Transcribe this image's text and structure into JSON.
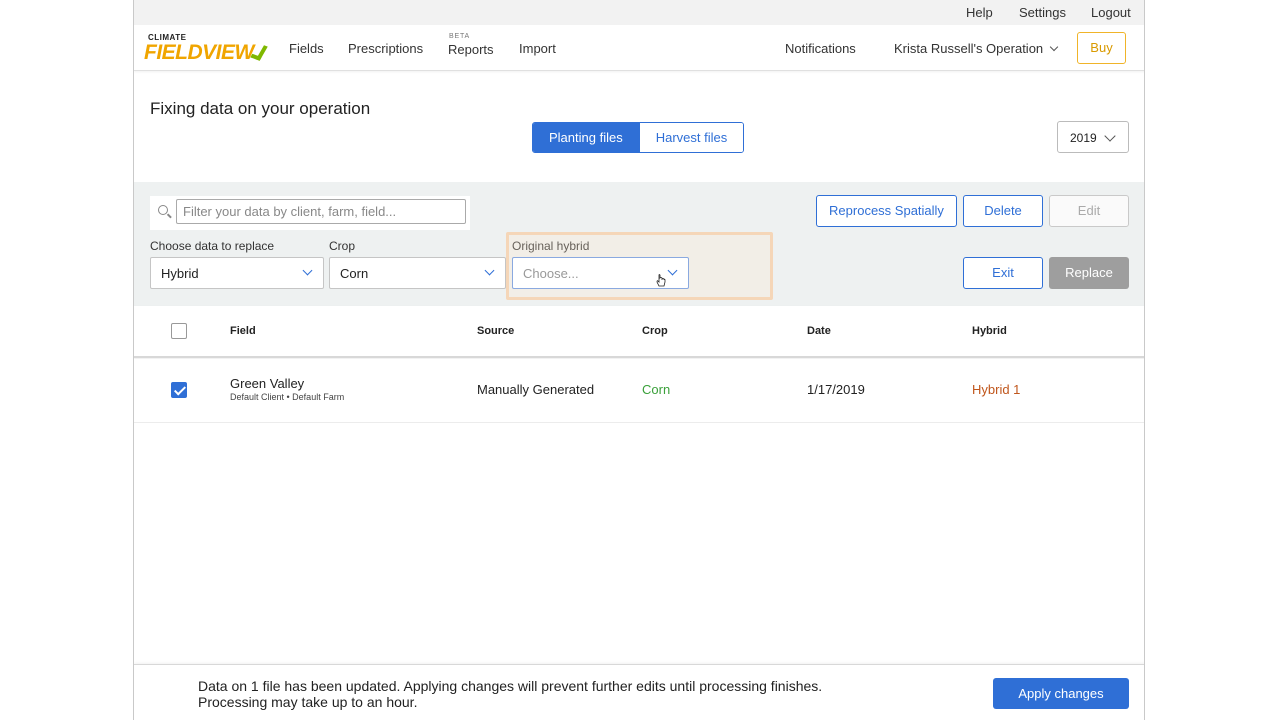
{
  "utility": {
    "help": "Help",
    "settings": "Settings",
    "logout": "Logout"
  },
  "logo": {
    "small": "CLIMATE",
    "big": "FIELDVIEW"
  },
  "nav": {
    "fields": "Fields",
    "prescriptions": "Prescriptions",
    "reports_badge": "BETA",
    "reports": "Reports",
    "import": "Import",
    "notifications": "Notifications",
    "operation": "Krista Russell's Operation",
    "buy": "Buy"
  },
  "page": {
    "title": "Fixing data on your operation",
    "tabs": [
      {
        "label": "Planting files",
        "active": true
      },
      {
        "label": "Harvest files",
        "active": false
      }
    ],
    "year": "2019"
  },
  "filters": {
    "search_placeholder": "Filter your data by client, farm, field...",
    "data_to_replace_label": "Choose data to replace",
    "data_to_replace_value": "Hybrid",
    "crop_label": "Crop",
    "crop_value": "Corn",
    "original_hybrid_label": "Original hybrid",
    "original_hybrid_value": "Choose..."
  },
  "actions": {
    "reprocess": "Reprocess Spatially",
    "delete": "Delete",
    "edit": "Edit",
    "exit": "Exit",
    "replace": "Replace"
  },
  "table": {
    "columns": [
      "Field",
      "Source",
      "Crop",
      "Date",
      "Hybrid"
    ],
    "rows": [
      {
        "checked": true,
        "field": "Green Valley",
        "field_sub": "Default Client • Default Farm",
        "source": "Manually Generated",
        "crop": "Corn",
        "date": "1/17/2019",
        "hybrid": "Hybrid 1"
      }
    ]
  },
  "footer": {
    "line1": "Data on 1 file has been updated. Applying changes will prevent further edits until processing finishes.",
    "line2": "Processing may take up to an hour.",
    "apply": "Apply changes"
  },
  "colors": {
    "primary": "#2f6fd6",
    "crop_green": "#3aa03a",
    "hybrid_orange": "#c0561c",
    "buy": "#f0b429"
  }
}
